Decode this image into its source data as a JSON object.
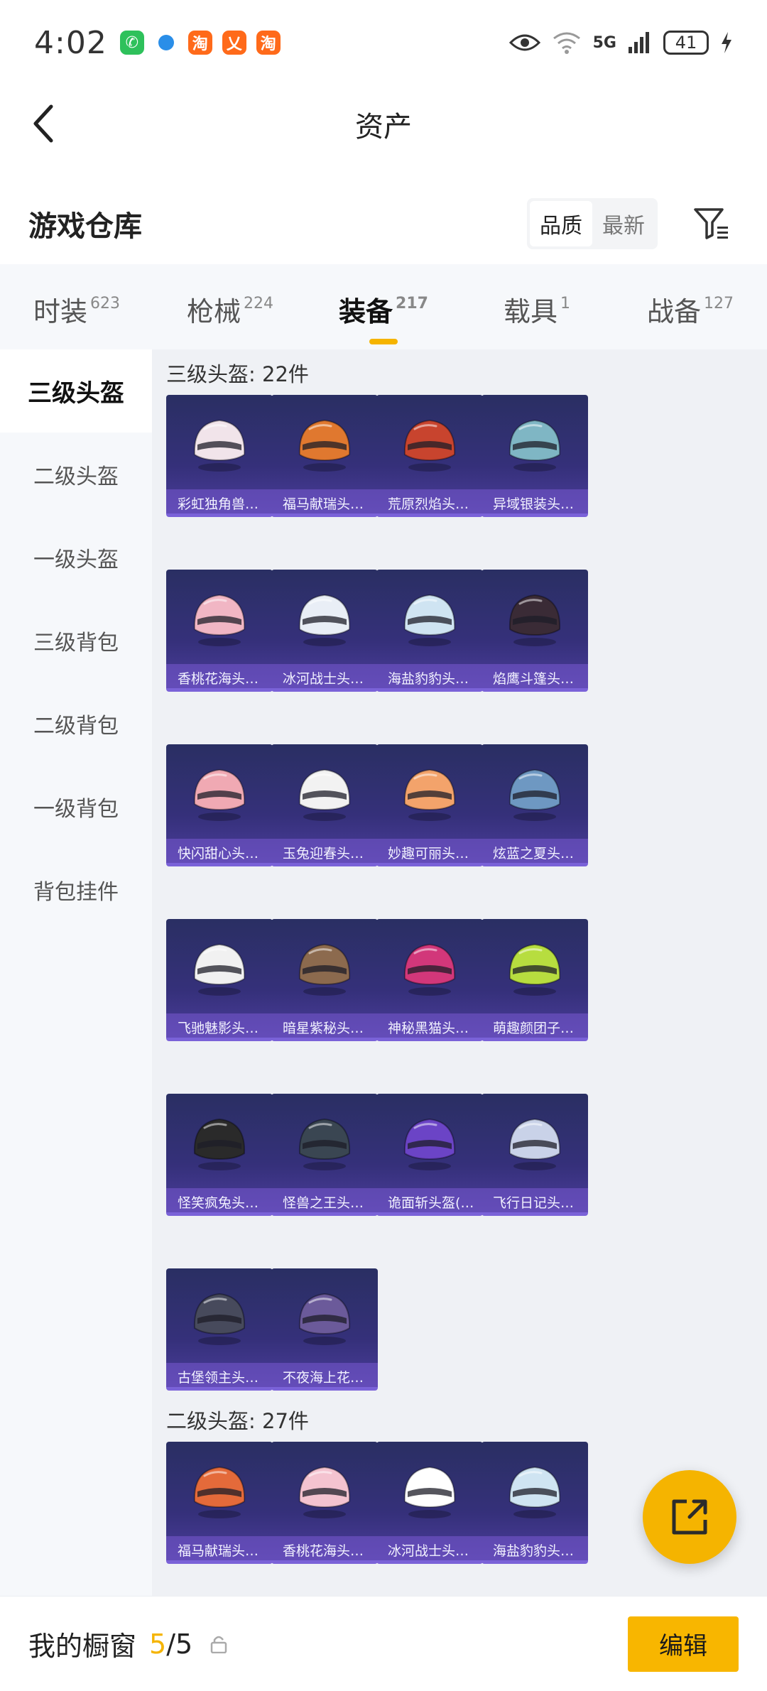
{
  "status": {
    "time": "4:02",
    "apps": [
      {
        "icon": "wechat-icon",
        "glyph": "✆"
      },
      {
        "icon": "browser-icon",
        "glyph": ""
      },
      {
        "icon": "taobao-icon",
        "glyph": "淘"
      },
      {
        "icon": "xianyu-icon",
        "glyph": "乂"
      },
      {
        "icon": "taobao-icon",
        "glyph": "淘"
      }
    ],
    "network": "5G",
    "battery": "41"
  },
  "nav": {
    "title": "资产"
  },
  "section": {
    "title": "游戏仓库",
    "sort_quality": "品质",
    "sort_newest": "最新"
  },
  "tabs": [
    {
      "label": "时装",
      "count": "623"
    },
    {
      "label": "枪械",
      "count": "224"
    },
    {
      "label": "装备",
      "count": "217"
    },
    {
      "label": "载具",
      "count": "1"
    },
    {
      "label": "战备",
      "count": "127"
    }
  ],
  "sidebar": {
    "items": [
      "三级头盔",
      "二级头盔",
      "一级头盔",
      "三级背包",
      "二级背包",
      "一级背包",
      "背包挂件"
    ]
  },
  "groups": [
    {
      "title": "三级头盔: 22件",
      "items": [
        {
          "name": "彩虹独角兽…",
          "color": "#f1e4ea"
        },
        {
          "name": "福马献瑞头…",
          "color": "#e0782f"
        },
        {
          "name": "荒原烈焰头…",
          "color": "#c8442e"
        },
        {
          "name": "异域银装头…",
          "color": "#7fb6c4"
        },
        {
          "name": "香桃花海头…",
          "color": "#f1b6c4"
        },
        {
          "name": "冰河战士头…",
          "color": "#e9eef6"
        },
        {
          "name": "海盐豹豹头…",
          "color": "#cfe4f2"
        },
        {
          "name": "焰鹰斗篷头…",
          "color": "#3a2b36"
        },
        {
          "name": "快闪甜心头…",
          "color": "#f0a9b3"
        },
        {
          "name": "玉兔迎春头…",
          "color": "#f2f2f2"
        },
        {
          "name": "妙趣可丽头…",
          "color": "#f3a36b"
        },
        {
          "name": "炫蓝之夏头…",
          "color": "#6e98c2"
        },
        {
          "name": "飞驰魅影头…",
          "color": "#f1f1f1"
        },
        {
          "name": "暗星紫秘头…",
          "color": "#8c6a4e"
        },
        {
          "name": "神秘黑猫头…",
          "color": "#d2377a"
        },
        {
          "name": "萌趣颜团子…",
          "color": "#b7dd3f"
        },
        {
          "name": "怪笑疯兔头…",
          "color": "#2a2a2a"
        },
        {
          "name": "怪兽之王头…",
          "color": "#3a4652"
        },
        {
          "name": "诡面斩头盔(…",
          "color": "#6b44c6"
        },
        {
          "name": "飞行日记头…",
          "color": "#c9d2e8"
        },
        {
          "name": "古堡领主头…",
          "color": "#474a5c"
        },
        {
          "name": "不夜海上花…",
          "color": "#6b5a9a"
        }
      ]
    },
    {
      "title": "二级头盔: 27件",
      "items": [
        {
          "name": "福马献瑞头…",
          "color": "#e46a3a"
        },
        {
          "name": "香桃花海头…",
          "color": "#f4c3d0"
        },
        {
          "name": "冰河战士头…",
          "color": "#ffffff"
        },
        {
          "name": "海盐豹豹头…",
          "color": "#cfe4f2"
        }
      ]
    }
  ],
  "bottom": {
    "label": "我的橱窗",
    "current": "5",
    "total": "/5",
    "edit": "编辑"
  }
}
